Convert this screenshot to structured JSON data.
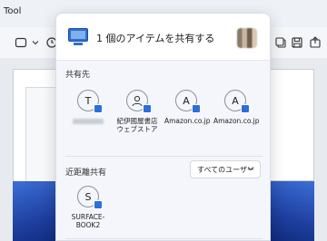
{
  "app": {
    "title": "Tool"
  },
  "share": {
    "title": "1 個のアイテムを共有する",
    "section_share_with": "共有先",
    "contacts": [
      {
        "initial": "T",
        "name": ""
      },
      {
        "initial": "",
        "name": "紀伊國屋書店\nウェブストア"
      },
      {
        "initial": "A",
        "name": "Amazon.co.jp"
      },
      {
        "initial": "A",
        "name": "Amazon.co.jp"
      }
    ],
    "section_nearby": "近距離共有",
    "nearby_filter": {
      "selected": "すべてのユーザー"
    },
    "nearby_devices": [
      {
        "initial": "S",
        "name": "SURFACE-\nBOOK2"
      }
    ]
  },
  "colors": {
    "accent": "#2a6fdb",
    "panel": "#f4f6fb"
  }
}
